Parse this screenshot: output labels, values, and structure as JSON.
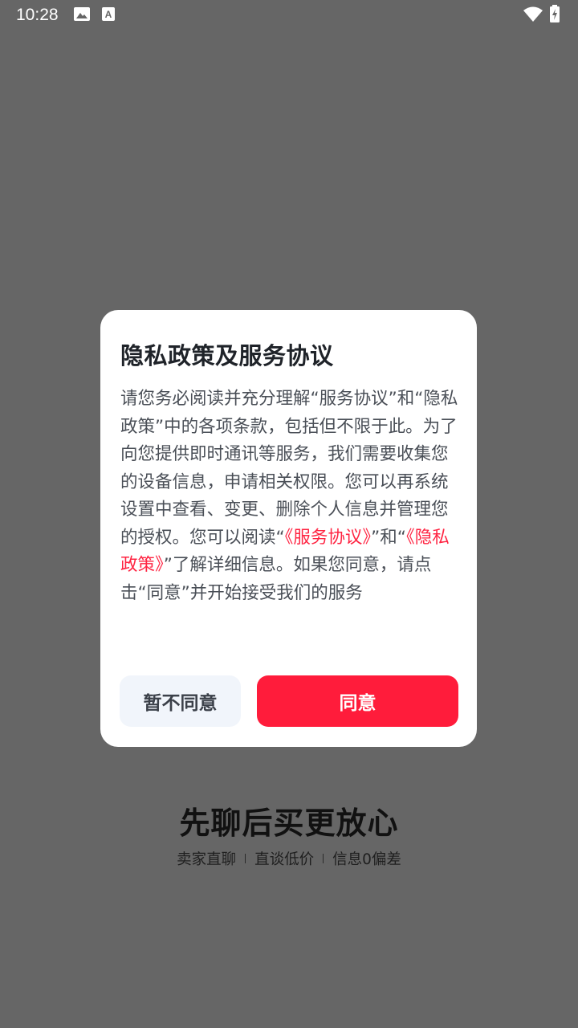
{
  "status_bar": {
    "time": "10:28",
    "icons": [
      "image-icon",
      "text-a-icon",
      "wifi-icon",
      "battery-charging-icon"
    ]
  },
  "dialog": {
    "title": "隐私政策及服务协议",
    "body": {
      "part1": "请您务必阅读并充分理解“服务协议”和“隐私政策”中的各项条款，包括但不限于此。为了向您提供即时通讯等服务，我们需要收集您的设备信息，申请相关权限。您可以再系统设置中查看、变更、删除个人信息并管理您的授权。您可以阅读“",
      "link_service": "《服务协议》",
      "part2": "”和“",
      "link_privacy": "《隐私政策》",
      "part3": "”了解详细信息。如果您同意，请点击“同意”并开始接受我们的服务"
    },
    "decline_label": "暂不同意",
    "agree_label": "同意"
  },
  "background": {
    "slogan": "先聊后买更放心",
    "features": [
      "卖家直聊",
      "直谈低价",
      "信息0偏差"
    ]
  },
  "colors": {
    "overlay": "#666666",
    "accent": "#ff1c3b",
    "link": "#ff2442",
    "decline_bg": "#f1f5fb"
  }
}
